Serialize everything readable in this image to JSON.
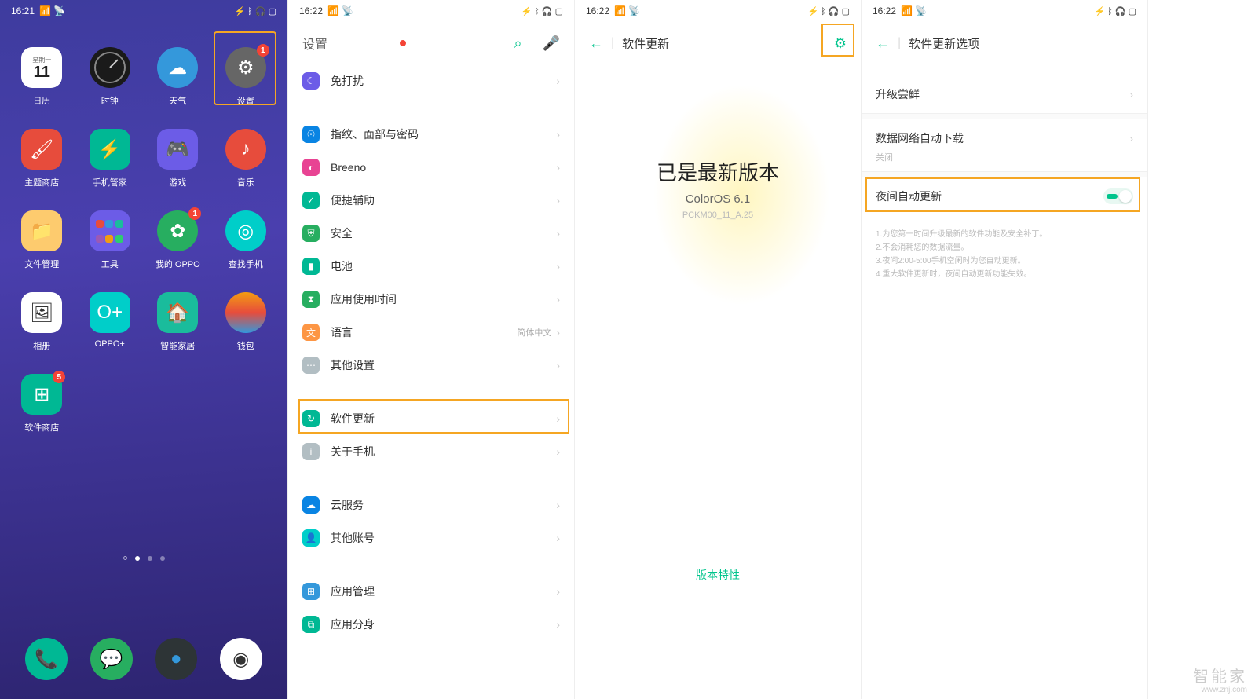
{
  "status": {
    "time1": "16:21",
    "time2": "16:22",
    "icons_right": "⚳ ⁂ ᛒ ⊙ □"
  },
  "home": {
    "apps": [
      {
        "label": "日历",
        "day": "星期一",
        "num": "11"
      },
      {
        "label": "时钟"
      },
      {
        "label": "天气"
      },
      {
        "label": "设置",
        "badge": "1"
      },
      {
        "label": "主题商店"
      },
      {
        "label": "手机管家"
      },
      {
        "label": "游戏"
      },
      {
        "label": "音乐"
      },
      {
        "label": "文件管理"
      },
      {
        "label": "工具"
      },
      {
        "label": "我的 OPPO",
        "badge": "1"
      },
      {
        "label": "查找手机"
      },
      {
        "label": "相册"
      },
      {
        "label": "OPPO+"
      },
      {
        "label": "智能家居"
      },
      {
        "label": "钱包"
      },
      {
        "label": "软件商店",
        "badge": "5"
      }
    ]
  },
  "settings": {
    "title": "设置",
    "items": [
      {
        "label": "免打扰"
      },
      {
        "label": "指纹、面部与密码"
      },
      {
        "label": "Breeno"
      },
      {
        "label": "便捷辅助"
      },
      {
        "label": "安全"
      },
      {
        "label": "电池"
      },
      {
        "label": "应用使用时间"
      },
      {
        "label": "语言",
        "sub": "简体中文"
      },
      {
        "label": "其他设置"
      },
      {
        "label": "软件更新"
      },
      {
        "label": "关于手机"
      },
      {
        "label": "云服务"
      },
      {
        "label": "其他账号"
      },
      {
        "label": "应用管理"
      },
      {
        "label": "应用分身"
      }
    ]
  },
  "update": {
    "title": "软件更新",
    "main": "已是最新版本",
    "os": "ColorOS 6.1",
    "build": "PCKM00_11_A.25",
    "feature": "版本特性"
  },
  "options": {
    "title": "软件更新选项",
    "r1": "升级尝鲜",
    "r2": "数据网络自动下载",
    "r2_sub": "关闭",
    "r3": "夜间自动更新",
    "notes": [
      "1.为您第一时间升级最新的软件功能及安全补丁。",
      "2.不会消耗您的数据流量。",
      "3.夜间2:00-5:00手机空闲时为您自动更新。",
      "4.重大软件更新时，夜间自动更新功能失效。"
    ]
  },
  "watermark": {
    "main": "智能家",
    "sub": "www.znj.com"
  }
}
